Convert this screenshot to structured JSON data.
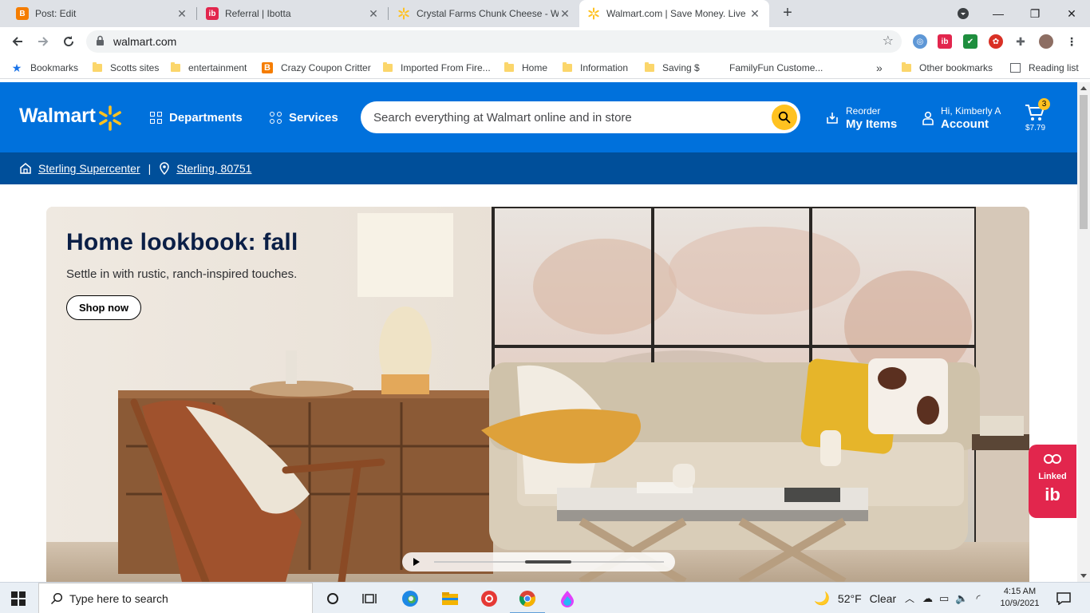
{
  "browser": {
    "tabs": [
      {
        "title": "Post: Edit",
        "favicon": "blogger-icon",
        "favicon_color": "#f57d00",
        "favicon_char": "B"
      },
      {
        "title": "Referral | Ibotta",
        "favicon": "ibotta-icon",
        "favicon_color": "#e2264d",
        "favicon_char": "ib"
      },
      {
        "title": "Crystal Farms Chunk Cheese - Wa",
        "favicon": "walmart-spark-icon",
        "favicon_color": "#ffc220",
        "favicon_char": ""
      },
      {
        "title": "Walmart.com | Save Money. Live",
        "favicon": "walmart-spark-icon",
        "favicon_color": "#ffc220",
        "favicon_char": ""
      }
    ],
    "active_tab": 3,
    "url": "walmart.com",
    "bookmarks": [
      {
        "label": "Bookmarks",
        "type": "star"
      },
      {
        "label": "Scotts sites",
        "type": "folder"
      },
      {
        "label": "entertainment",
        "type": "folder"
      },
      {
        "label": "Crazy Coupon Critter",
        "type": "blogger"
      },
      {
        "label": "Imported From Fire...",
        "type": "folder"
      },
      {
        "label": "Home",
        "type": "folder"
      },
      {
        "label": "Information",
        "type": "folder"
      },
      {
        "label": "Saving $",
        "type": "folder"
      },
      {
        "label": "FamilyFun Custome...",
        "type": "none"
      }
    ],
    "overflow": "»",
    "other_bookmarks": "Other bookmarks",
    "reading_list": "Reading list"
  },
  "walmart": {
    "logo": "Walmart",
    "departments": "Departments",
    "services": "Services",
    "search_placeholder": "Search everything at Walmart online and in store",
    "reorder_small": "Reorder",
    "reorder_big": "My Items",
    "account_small": "Hi, Kimberly A",
    "account_big": "Account",
    "cart_count": "3",
    "cart_total": "$7.79",
    "store": "Sterling Supercenter",
    "separator": "|",
    "location": "Sterling, 80751",
    "brand_blue": "#0071dc",
    "brand_yellow": "#ffc220"
  },
  "hero": {
    "title": "Home lookbook: fall",
    "subtitle": "Settle in with rustic, ranch-inspired touches.",
    "cta": "Shop now"
  },
  "ibotta_widget": {
    "label": "Linked",
    "logo": "ib"
  },
  "taskbar": {
    "search_placeholder": "Type here to search",
    "weather_temp": "52°F",
    "weather_text": "Clear",
    "time": "4:15 AM",
    "date": "10/9/2021"
  }
}
